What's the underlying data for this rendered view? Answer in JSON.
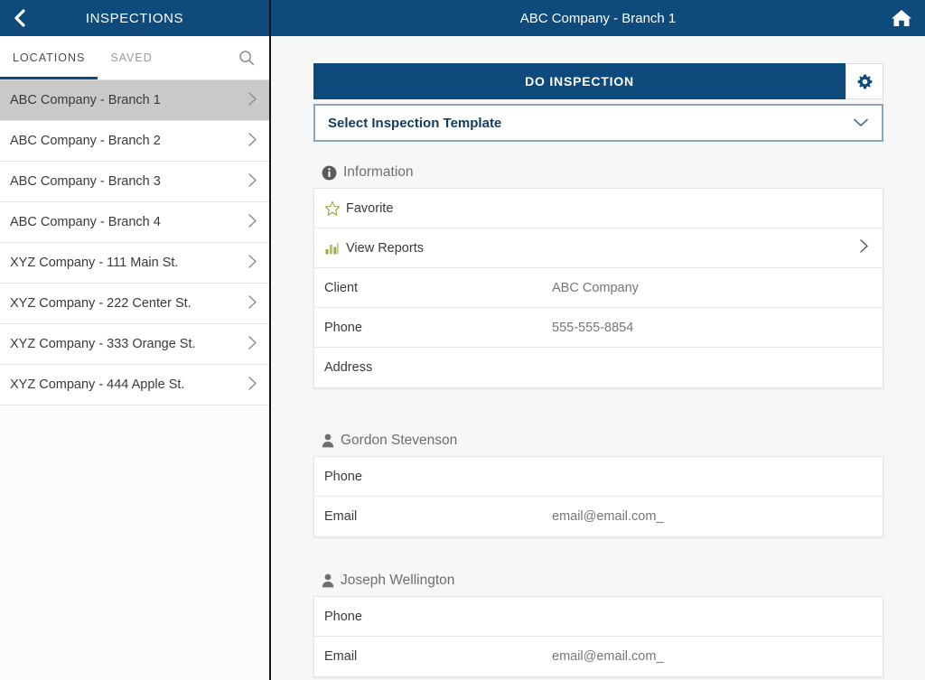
{
  "sidebar": {
    "header": {
      "title": "INSPECTIONS",
      "back_icon": "chevron-left-icon"
    },
    "tabs": [
      {
        "label": "LOCATIONS",
        "active": true
      },
      {
        "label": "SAVED",
        "active": false
      }
    ],
    "search_icon": "search-icon",
    "locations": [
      {
        "label": "ABC Company - Branch 1",
        "selected": true
      },
      {
        "label": "ABC Company - Branch 2",
        "selected": false
      },
      {
        "label": "ABC Company - Branch 3",
        "selected": false
      },
      {
        "label": "ABC Company - Branch 4",
        "selected": false
      },
      {
        "label": "XYZ Company - 111 Main St.",
        "selected": false
      },
      {
        "label": "XYZ Company - 222 Center St.",
        "selected": false
      },
      {
        "label": "XYZ Company - 333 Orange St.",
        "selected": false
      },
      {
        "label": "XYZ Company - 444 Apple St.",
        "selected": false
      }
    ]
  },
  "main": {
    "header": {
      "title": "ABC Company - Branch 1",
      "home_icon": "home-icon"
    },
    "do_inspection": {
      "label": "DO INSPECTION",
      "settings_icon": "gear-icon"
    },
    "template": {
      "value": "Select Inspection Template",
      "chevron_icon": "chevron-down-icon"
    },
    "information": {
      "title": "Information",
      "icon": "info-icon",
      "favorite": {
        "label": "Favorite",
        "icon": "star-outline-icon"
      },
      "view_reports": {
        "label": "View Reports",
        "icon": "bar-chart-icon",
        "chevron_icon": "chevron-right-icon"
      },
      "fields": [
        {
          "label": "Client",
          "value": "ABC Company"
        },
        {
          "label": "Phone",
          "value": "555-555-8854"
        },
        {
          "label": "Address",
          "value": ""
        }
      ]
    },
    "contacts": [
      {
        "name": "Gordon Stevenson",
        "icon": "person-icon",
        "fields": [
          {
            "label": "Phone",
            "value": ""
          },
          {
            "label": "Email",
            "value": "email@email.com_"
          }
        ]
      },
      {
        "name": "Joseph Wellington",
        "icon": "person-icon",
        "fields": [
          {
            "label": "Phone",
            "value": ""
          },
          {
            "label": "Email",
            "value": "email@email.com_"
          }
        ]
      }
    ]
  },
  "colors": {
    "header_blue": "#0e4a7b",
    "accent_olive": "#97a83c",
    "selected_gray": "#c9c9c9",
    "border_steel": "#8aa6bd"
  }
}
